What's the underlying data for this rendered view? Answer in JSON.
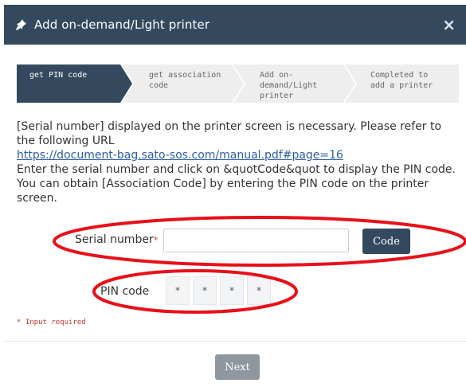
{
  "dialog": {
    "title": "Add on-demand/Light printer",
    "close_symbol": "×",
    "header_color": "#34495e",
    "title_icon": "pushpin-icon",
    "close_icon": "close-icon"
  },
  "steps": [
    {
      "label": "get PIN code",
      "active": true
    },
    {
      "label": "get association\ncode",
      "active": false
    },
    {
      "label": "Add on-\ndemand/Light\nprinter",
      "active": false
    },
    {
      "label": "Completed to\nadd a printer",
      "active": false
    }
  ],
  "description": {
    "line1": "[Serial number] displayed on the printer screen is necessary. Please refer to the following URL",
    "url": "https://document-bag.sato-sos.com/manual.pdf#page=16",
    "line2": "Enter the serial number and click on &quotCode&quot to display the PIN code. You can obtain [Association Code] by entering the PIN code on the printer screen."
  },
  "form": {
    "serial_label": "Serial number",
    "required_mark": "*",
    "serial_value": "",
    "code_button": "Code",
    "pin_label": "PIN code",
    "pin_digits": [
      "*",
      "*",
      "*",
      "*"
    ],
    "required_note": "* Input required"
  },
  "footer": {
    "next_button": "Next"
  },
  "colors": {
    "accent": "#34495e",
    "annotation": "#e8101a",
    "required": "#c0392b",
    "link": "#2a5ea8",
    "disabled_button": "#8e969e"
  }
}
